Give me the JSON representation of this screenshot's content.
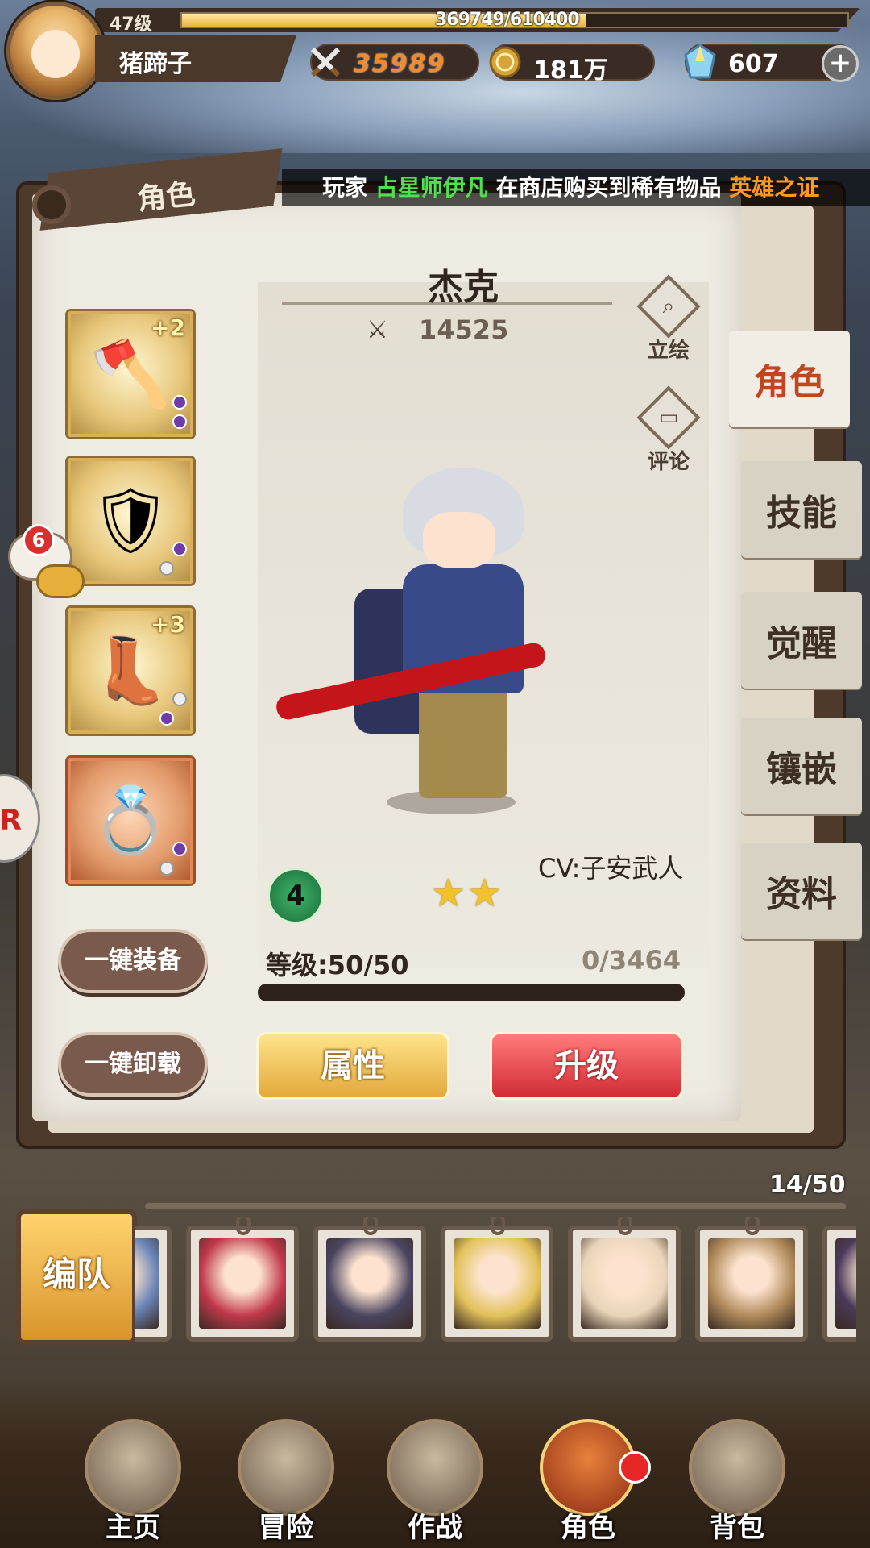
{
  "player": {
    "level": "47级",
    "xp_text": "369749/610400",
    "xp_ratio": 0.606,
    "name": "猪蹄子"
  },
  "resources": {
    "power": "35989",
    "gold": "181万",
    "gems": "607",
    "add_label": "+"
  },
  "ticker": {
    "prefix": "玩家",
    "player": "占星师伊凡",
    "middle": "在商店购买到稀有物品",
    "item": "英雄之证"
  },
  "section_title": "角色",
  "tabs": [
    "角色",
    "技能",
    "觉醒",
    "镶嵌",
    "资料"
  ],
  "character": {
    "name": "杰克",
    "power": "14525",
    "portrait_label": "立绘",
    "comment_label": "评论",
    "cv": "CV:子安武人",
    "rank": "4",
    "stars": "★★",
    "level_text": "等级:50/50",
    "exp_text": "0/3464",
    "exp_ratio": 0
  },
  "equipment": [
    {
      "icon": "axe-icon",
      "plus": "+2"
    },
    {
      "icon": "armor-icon",
      "plus": ""
    },
    {
      "icon": "boots-icon",
      "plus": "+3"
    },
    {
      "icon": "ring-icon",
      "plus": ""
    }
  ],
  "chat_badge": "6",
  "buttons": {
    "equip_all": "一键装备",
    "unequip_all": "一键卸载",
    "attributes": "属性",
    "upgrade": "升级",
    "team": "编队"
  },
  "roster": {
    "count": "14/50",
    "colors": [
      "#6b86b8",
      "#c0384a",
      "#4a4460",
      "#e2c25a",
      "#e9d4b8",
      "#b08a5a",
      "#4a3a5a"
    ]
  },
  "nav": [
    "主页",
    "冒险",
    "作战",
    "角色",
    "背包"
  ],
  "colors": {
    "accent_red": "#c0461f",
    "gold": "#e3a93a",
    "upgrade_red": "#d22b34"
  }
}
